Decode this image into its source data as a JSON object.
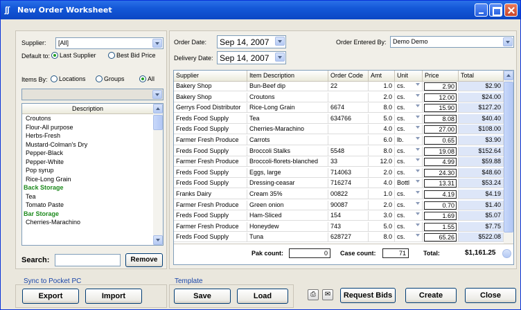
{
  "window": {
    "title": "New Order Worksheet"
  },
  "left": {
    "supplier_label": "Supplier:",
    "supplier_value": "[All]",
    "default_to_label": "Default to:",
    "default_options": [
      {
        "label": "Last Supplier",
        "selected": true
      },
      {
        "label": "Best Bid Price",
        "selected": false
      }
    ],
    "items_by_label": "Items By:",
    "items_by_options": [
      {
        "label": "Locations",
        "selected": false
      },
      {
        "label": "Groups",
        "selected": false
      },
      {
        "label": "All",
        "selected": true
      }
    ],
    "filter_value": "",
    "list_header": "Description",
    "list_items": [
      {
        "text": "Croutons",
        "group": false
      },
      {
        "text": "Flour-All purpose",
        "group": false
      },
      {
        "text": "Herbs-Fresh",
        "group": false
      },
      {
        "text": "Mustard-Colman's Dry",
        "group": false
      },
      {
        "text": "Pepper-Black",
        "group": false
      },
      {
        "text": "Pepper-White",
        "group": false
      },
      {
        "text": "Pop syrup",
        "group": false
      },
      {
        "text": "Rice-Long Grain",
        "group": false
      },
      {
        "text": "Back Storage",
        "group": true
      },
      {
        "text": "Tea",
        "group": false
      },
      {
        "text": "Tomato Paste",
        "group": false
      },
      {
        "text": "Bar Storage",
        "group": true
      },
      {
        "text": "Cherries-Marachino",
        "group": false
      }
    ],
    "search_label": "Search:",
    "search_value": "",
    "remove_label": "Remove"
  },
  "header": {
    "order_date_label": "Order Date:",
    "order_date_value": "Sep 14, 2007",
    "delivery_date_label": "Delivery Date:",
    "delivery_date_value": "Sep 14, 2007",
    "entered_by_label": "Order Entered By:",
    "entered_by_value": "Demo Demo"
  },
  "grid": {
    "columns": [
      "Supplier",
      "Item Description",
      "Order Code",
      "Amt",
      "Unit",
      "Price",
      "Total"
    ],
    "rows": [
      [
        "Bakery Shop",
        "Bun-Beef dip",
        "22",
        "1.0",
        "cs.",
        "2.90",
        "$2.90"
      ],
      [
        "Bakery Shop",
        "Croutons",
        "",
        "2.0",
        "cs.",
        "12.00",
        "$24.00"
      ],
      [
        "Gerrys Food Distributor",
        "Rice-Long Grain",
        "6674",
        "8.0",
        "cs.",
        "15.90",
        "$127.20"
      ],
      [
        "Freds Food Supply",
        "Tea",
        "634766",
        "5.0",
        "cs.",
        "8.08",
        "$40.40"
      ],
      [
        "Freds Food Supply",
        "Cherries-Marachino",
        "",
        "4.0",
        "cs.",
        "27.00",
        "$108.00"
      ],
      [
        "Farmer Fresh Produce",
        "Carrots",
        "",
        "6.0",
        "lb.",
        "0.65",
        "$3.90"
      ],
      [
        "Freds Food Supply",
        "Broccoli Stalks",
        "5548",
        "8.0",
        "cs.",
        "19.08",
        "$152.64"
      ],
      [
        "Farmer Fresh Produce",
        "Broccoli-florets-blanched",
        "33",
        "12.0",
        "cs.",
        "4.99",
        "$59.88"
      ],
      [
        "Freds Food Supply",
        "Eggs, large",
        "714063",
        "2.0",
        "cs.",
        "24.30",
        "$48.60"
      ],
      [
        "Freds Food Supply",
        "Dressing-ceasar",
        "716274",
        "4.0",
        "Bottl",
        "13.31",
        "$53.24"
      ],
      [
        "Franks Dairy",
        "Cream 35%",
        "00822",
        "1.0",
        "cs.",
        "4.19",
        "$4.19"
      ],
      [
        "Farmer Fresh Produce",
        "Green onion",
        "90087",
        "2.0",
        "cs.",
        "0.70",
        "$1.40"
      ],
      [
        "Freds Food Supply",
        "Ham-Sliced",
        "154",
        "3.0",
        "cs.",
        "1.69",
        "$5.07"
      ],
      [
        "Farmer Fresh Produce",
        "Honeydew",
        "743",
        "5.0",
        "cs.",
        "1.55",
        "$7.75"
      ],
      [
        "Freds Food Supply",
        "Tuna",
        "628727",
        "8.0",
        "cs.",
        "65.26",
        "$522.08"
      ]
    ],
    "pak_count_label": "Pak count:",
    "pak_count_value": "0",
    "case_count_label": "Case count:",
    "case_count_value": "71",
    "total_label": "Total:",
    "total_value": "$1,161.25"
  },
  "bottom": {
    "sync_title": "Sync to Pocket PC",
    "export_label": "Export",
    "import_label": "Import",
    "template_title": "Template",
    "save_label": "Save",
    "load_label": "Load",
    "request_bids_label": "Request Bids",
    "create_label": "Create",
    "close_label": "Close"
  }
}
